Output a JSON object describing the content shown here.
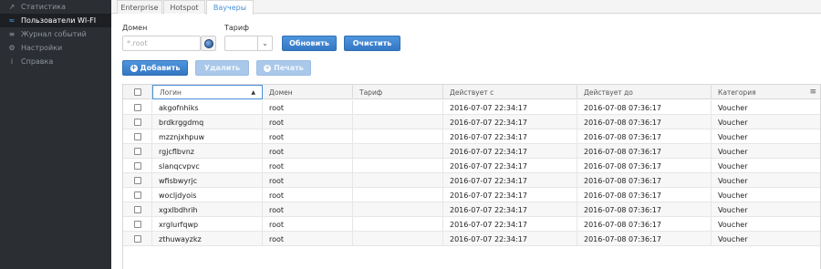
{
  "sidebar": {
    "items": [
      {
        "icon": "chart-icon",
        "glyph": "↗",
        "label": "Статистика",
        "active": false
      },
      {
        "icon": "wifi-icon",
        "glyph": "≈",
        "label": "Пользователи WI-FI",
        "active": true
      },
      {
        "icon": "list-icon",
        "glyph": "≡",
        "label": "Журнал событий",
        "active": false
      },
      {
        "icon": "gear-icon",
        "glyph": "⚙",
        "label": "Настройки",
        "active": false
      },
      {
        "icon": "info-icon",
        "glyph": "i",
        "label": "Справка",
        "active": false
      }
    ]
  },
  "tabs": [
    {
      "label": "Enterprise",
      "active": false
    },
    {
      "label": "Hotspot",
      "active": false
    },
    {
      "label": "Ваучеры",
      "active": true
    }
  ],
  "filters": {
    "domain_label": "Домен",
    "domain_placeholder": "*.root",
    "tariff_label": "Тариф",
    "refresh_label": "Обновить",
    "clear_label": "Очистить"
  },
  "toolbar": {
    "add_label": "Добавить",
    "delete_label": "Удалить",
    "print_label": "Печать"
  },
  "table": {
    "columns": [
      "Логин",
      "Домен",
      "Тариф",
      "Действует с",
      "Действует до",
      "Категория"
    ],
    "rows": [
      [
        "akgofnhiks",
        "root",
        "",
        "2016-07-07 22:34:17",
        "2016-07-08 07:36:17",
        "Voucher"
      ],
      [
        "brdkrggdmq",
        "root",
        "",
        "2016-07-07 22:34:17",
        "2016-07-08 07:36:17",
        "Voucher"
      ],
      [
        "mzznjxhpuw",
        "root",
        "",
        "2016-07-07 22:34:17",
        "2016-07-08 07:36:17",
        "Voucher"
      ],
      [
        "rgjcflbvnz",
        "root",
        "",
        "2016-07-07 22:34:17",
        "2016-07-08 07:36:17",
        "Voucher"
      ],
      [
        "slanqcvpvc",
        "root",
        "",
        "2016-07-07 22:34:17",
        "2016-07-08 07:36:17",
        "Voucher"
      ],
      [
        "wfisbwyrjc",
        "root",
        "",
        "2016-07-07 22:34:17",
        "2016-07-08 07:36:17",
        "Voucher"
      ],
      [
        "wocljdyois",
        "root",
        "",
        "2016-07-07 22:34:17",
        "2016-07-08 07:36:17",
        "Voucher"
      ],
      [
        "xgxlbdhrih",
        "root",
        "",
        "2016-07-07 22:34:17",
        "2016-07-08 07:36:17",
        "Voucher"
      ],
      [
        "xrglurfqwp",
        "root",
        "",
        "2016-07-07 22:34:17",
        "2016-07-08 07:36:17",
        "Voucher"
      ],
      [
        "zthuwayzkz",
        "root",
        "",
        "2016-07-07 22:34:17",
        "2016-07-08 07:36:17",
        "Voucher"
      ]
    ]
  }
}
